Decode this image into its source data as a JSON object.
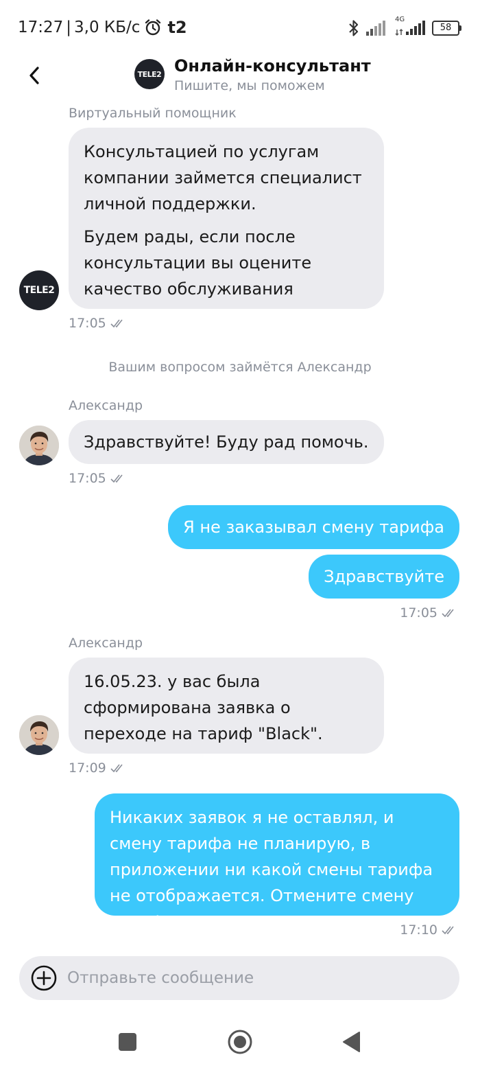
{
  "status_bar": {
    "time": "17:27",
    "separator": "|",
    "speed": "3,0 КБ/с",
    "carrier": "t2",
    "network": "4G",
    "battery": "58"
  },
  "header": {
    "logo_text": "TELE2",
    "title": "Онлайн-консультант",
    "subtitle": "Пишите, мы поможем"
  },
  "messages": {
    "m1": {
      "sender": "Виртуальный помощник",
      "avatar_text": "TELE2",
      "p1": "Консультацией по услугам компании займется специалист личной поддержки.",
      "p2": "Будем рады, если после консультации вы оцените качество обслуживания",
      "time": "17:05"
    },
    "system_note": "Вашим вопросом займётся Александр",
    "m2": {
      "sender": "Александр",
      "text": "Здравствуйте! Буду рад помочь.",
      "time": "17:05"
    },
    "m3": {
      "text": "Я не заказывал смену тарифа"
    },
    "m4": {
      "text": "Здравствуйте",
      "time": "17:05"
    },
    "m5": {
      "sender": "Александр",
      "text": "16.05.23. у вас была сформирована заявка о переходе на тариф \"Black\".",
      "time": "17:09"
    },
    "m6": {
      "text": "Никаких заявок я не оставлял, и смену тарифа не планирую, в приложении ни какой смены тарифа не отображается. Отмените смену тарифа",
      "time": "17:10"
    }
  },
  "composer": {
    "placeholder": "Отправьте сообщение"
  },
  "colors": {
    "outgoing_bubble": "#3cc8fb",
    "incoming_bubble": "#ebebef",
    "muted_text": "#8a8f99"
  }
}
